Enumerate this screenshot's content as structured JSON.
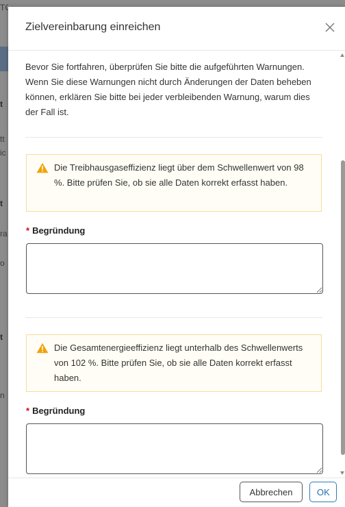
{
  "background": {
    "fragments": [
      {
        "text": "TC"
      },
      {
        "text": "t"
      },
      {
        "text": "tt"
      },
      {
        "text": "ic"
      },
      {
        "text": "t"
      },
      {
        "text": "ra"
      },
      {
        "text": "o"
      },
      {
        "text": "t"
      },
      {
        "text": "n"
      }
    ]
  },
  "dialog": {
    "title": "Zielvereinbarung einreichen",
    "close_icon": "close-icon",
    "intro": "Bevor Sie fortfahren, überprüfen Sie bitte die aufgeführten Warnungen. Wenn Sie diese Warnungen nicht durch Änderungen der Daten beheben können, erklären Sie bitte bei jeder verbleibenden Warnung, warum dies der Fall ist.",
    "warnings": [
      {
        "icon": "warning-icon",
        "text": "Die Treibhausgaseffizienz liegt über dem Schwellenwert von 98 %. Bitte prüfen Sie, ob sie alle Daten korrekt erfasst haben.",
        "field_required_marker": "*",
        "field_label": "Begründung",
        "field_value": ""
      },
      {
        "icon": "warning-icon",
        "text": "Die Gesamtenergieeffizienz liegt unterhalb des Schwellenwerts von 102 %. Bitte prüfen Sie, ob sie alle Daten korrekt erfasst haben.",
        "field_required_marker": "*",
        "field_label": "Begründung",
        "field_value": ""
      }
    ],
    "footer": {
      "cancel_label": "Abbrechen",
      "ok_label": "OK"
    }
  },
  "colors": {
    "warning_border": "#f5dc9e",
    "warning_icon": "#f0a30a",
    "required_marker": "#d0021b",
    "ok_button": "#1f6fb2",
    "backdrop": "#8c8c8c"
  }
}
